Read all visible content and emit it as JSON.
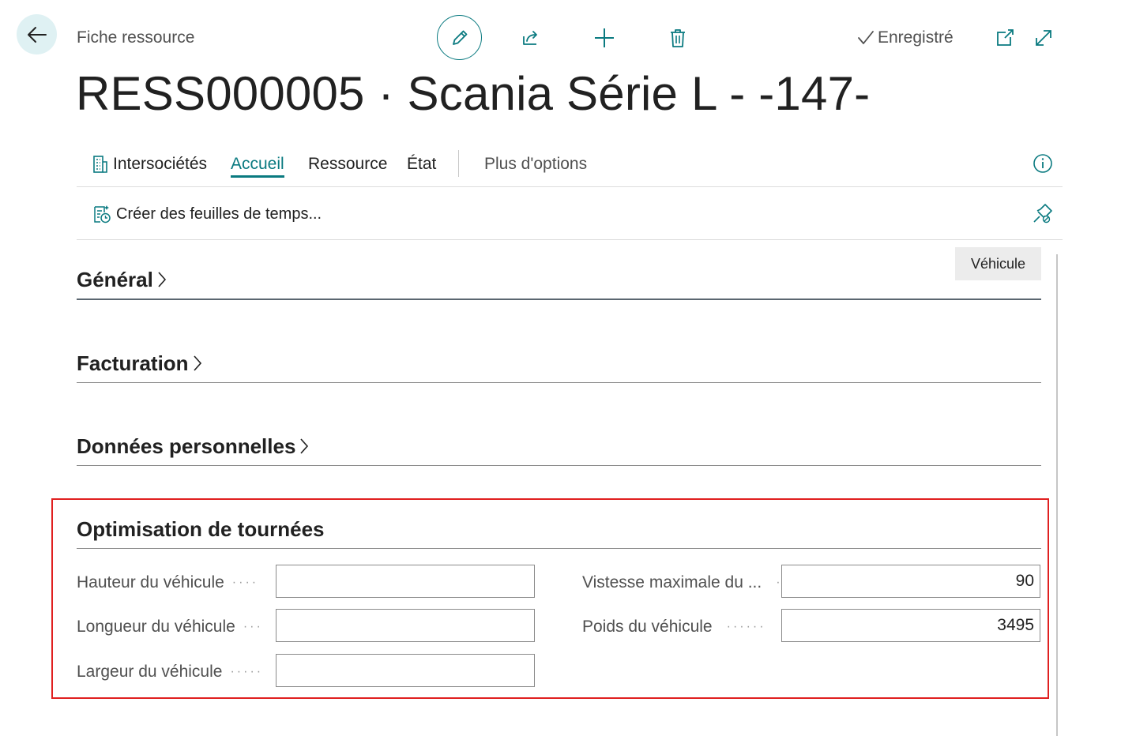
{
  "header": {
    "caption": "Fiche ressource",
    "record_title": "RESS000005 · Scania Série L - -147-",
    "saved_label": "Enregistré",
    "icons": [
      "back-arrow-icon",
      "pencil-icon",
      "share-icon",
      "plus-icon",
      "trash-icon",
      "checkmark-icon",
      "open-new-window-icon",
      "expand-icon"
    ]
  },
  "nav": {
    "items": [
      {
        "label": "Intersociétés",
        "icon": "building-icon"
      },
      {
        "label": "Accueil",
        "active": true
      },
      {
        "label": "Ressource"
      },
      {
        "label": "État"
      }
    ],
    "more_label": "Plus d'options"
  },
  "actions": {
    "create_timesheets_label": "Créer des feuilles de temps..."
  },
  "sections": {
    "general": {
      "title": "Général",
      "tag": "Véhicule"
    },
    "invoicing": {
      "title": "Facturation"
    },
    "personal": {
      "title": "Données personnelles"
    },
    "routing": {
      "title": "Optimisation de tournées",
      "fields": {
        "height": {
          "label": "Hauteur du véhicule",
          "value": ""
        },
        "length": {
          "label": "Longueur du véhicule",
          "value": ""
        },
        "width": {
          "label": "Largeur du véhicule",
          "value": ""
        },
        "max_speed": {
          "label": "Vistesse maximale du ...",
          "value": "90"
        },
        "weight": {
          "label": "Poids du véhicule",
          "value": "3495"
        }
      }
    }
  },
  "colors": {
    "accent": "#0a7a80",
    "highlight_border": "#e02020",
    "back_button_bg": "#dff1f3"
  }
}
